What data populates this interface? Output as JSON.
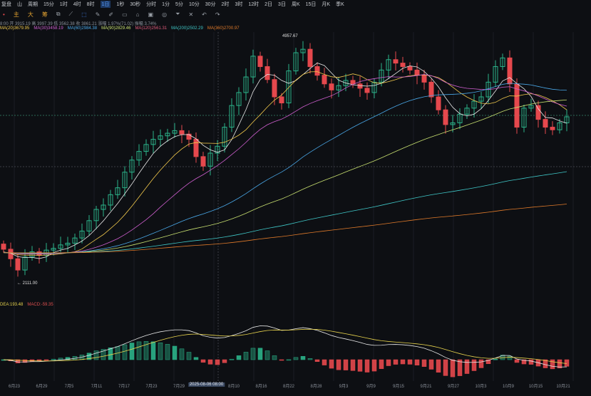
{
  "toolbar": {
    "replay": "复盘",
    "chart_type": "山",
    "period": "周期",
    "intervals": [
      "15分",
      "1时",
      "4时",
      "8时",
      "1日",
      "1秒",
      "30秒",
      "分时",
      "1分",
      "5分",
      "10分",
      "30分",
      "2时",
      "3时",
      "12时",
      "2日",
      "3日",
      "周K",
      "15日",
      "月K",
      "季K"
    ],
    "active_interval": "1日",
    "tools": [
      "主",
      "大",
      "筹"
    ]
  },
  "info": "8:00 开 3915.19 高 3997.39 低 3562.38 收 3861.21 涨幅 1.97%(71.02) 振幅 3.74%",
  "ma_labels": [
    {
      "text": "MA(20)3679.95",
      "color": "#f2c94c"
    },
    {
      "text": "MA(30)3458.19",
      "color": "#d05fd0"
    },
    {
      "text": "MA(60)2984.38",
      "color": "#4aa8e8"
    },
    {
      "text": "MA(90)2829.46",
      "color": "#c8e070"
    },
    {
      "text": "MA(120)2561.31",
      "color": "#e05a7a"
    },
    {
      "text": "MA(200)2502.29",
      "color": "#3fc7c7"
    },
    {
      "text": "MA(360)2700.97",
      "color": "#e07a2a"
    }
  ],
  "macd_labels": [
    {
      "text": "DEA:193.48",
      "color": "#e8d44d"
    },
    {
      "text": "MACD:-59.35",
      "color": "#e05050"
    }
  ],
  "price_labels": {
    "high": "4957.67",
    "low": "2111.00"
  },
  "x_labels": [
    "6月23",
    "6月29",
    "7月5",
    "7月11",
    "7月17",
    "7月23",
    "7月29",
    "2025-08-06 08:00",
    "8月10",
    "8月16",
    "8月22",
    "8月28",
    "9月3",
    "9月9",
    "9月15",
    "9月21",
    "9月27",
    "10月3",
    "10月9",
    "10月15",
    "10月21"
  ],
  "colors": {
    "up": "#2bb38a",
    "down": "#e5484d"
  },
  "chart_data": {
    "type": "candlestick",
    "price_range": [
      2111,
      4957.67
    ],
    "closes": [
      2490,
      2380,
      2250,
      2400,
      2460,
      2420,
      2480,
      2500,
      2540,
      2560,
      2620,
      2700,
      2820,
      2950,
      3000,
      3120,
      3200,
      3380,
      3520,
      3620,
      3700,
      3760,
      3800,
      3830,
      3860,
      3820,
      3760,
      3560,
      3450,
      3600,
      3680,
      3900,
      4150,
      4300,
      4480,
      4720,
      4600,
      4450,
      4250,
      4180,
      4550,
      4760,
      4800,
      4600,
      4500,
      4400,
      4330,
      4380,
      4440,
      4400,
      4350,
      4300,
      4420,
      4560,
      4680,
      4640,
      4600,
      4560,
      4500,
      4420,
      4250,
      4100,
      3930,
      3950,
      4050,
      4120,
      4200,
      4250,
      4420,
      4600,
      4700,
      4400,
      3900,
      4120,
      4150,
      3990,
      3900,
      3870,
      3950,
      4020
    ]
  }
}
